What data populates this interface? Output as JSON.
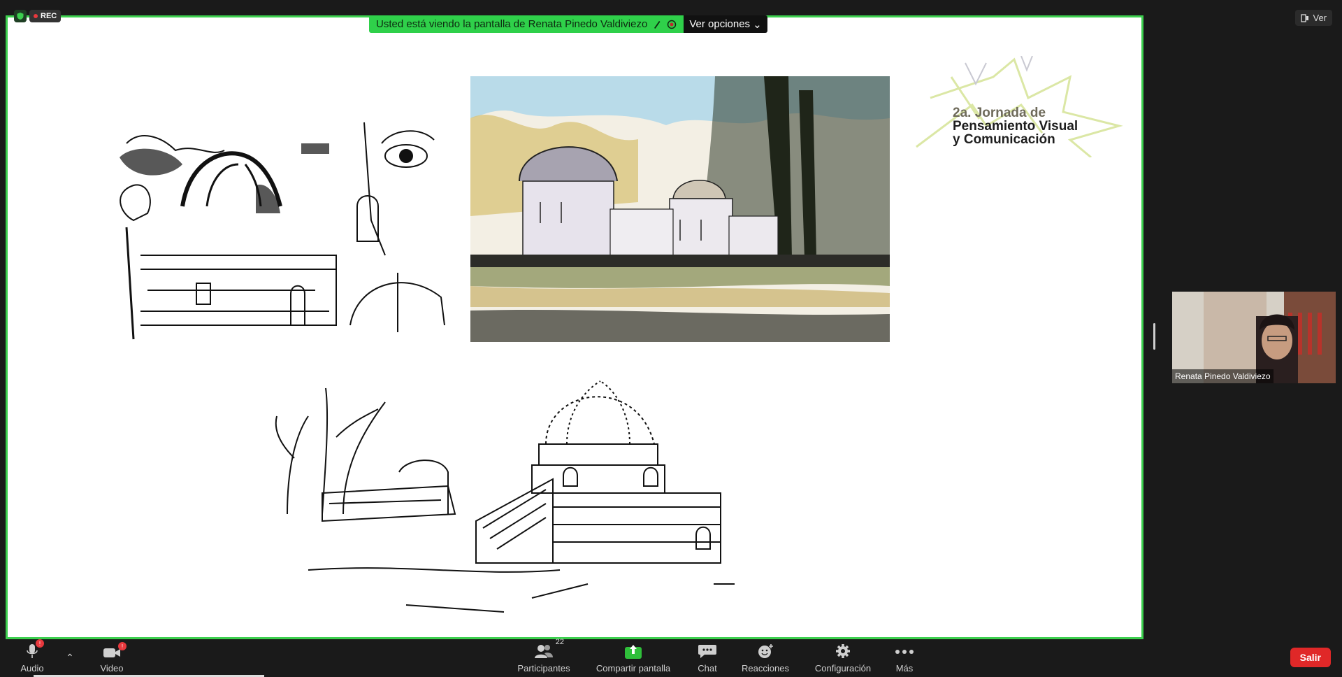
{
  "recording": {
    "label": "REC"
  },
  "banner": {
    "viewing_text": "Usted está viendo la pantalla de Renata Pinedo Valdiviezo",
    "options_label": "Ver opciones"
  },
  "top_right": {
    "view_label": "Ver"
  },
  "slide": {
    "logo_line1": "2a. Jornada de",
    "logo_line2": "Pensamiento Visual",
    "logo_line3": "y Comunicación"
  },
  "participant": {
    "name": "Renata Pinedo Valdiviezo"
  },
  "toolbar": {
    "audio_label": "Audio",
    "video_label": "Video",
    "participants_label": "Participantes",
    "participants_count": "22",
    "share_label": "Compartir pantalla",
    "chat_label": "Chat",
    "reactions_label": "Reacciones",
    "settings_label": "Configuración",
    "more_label": "Más",
    "exit_label": "Salir"
  },
  "colors": {
    "share_border": "#3ccf4e",
    "exit": "#e02828",
    "share_icon": "#2fbf3a"
  }
}
